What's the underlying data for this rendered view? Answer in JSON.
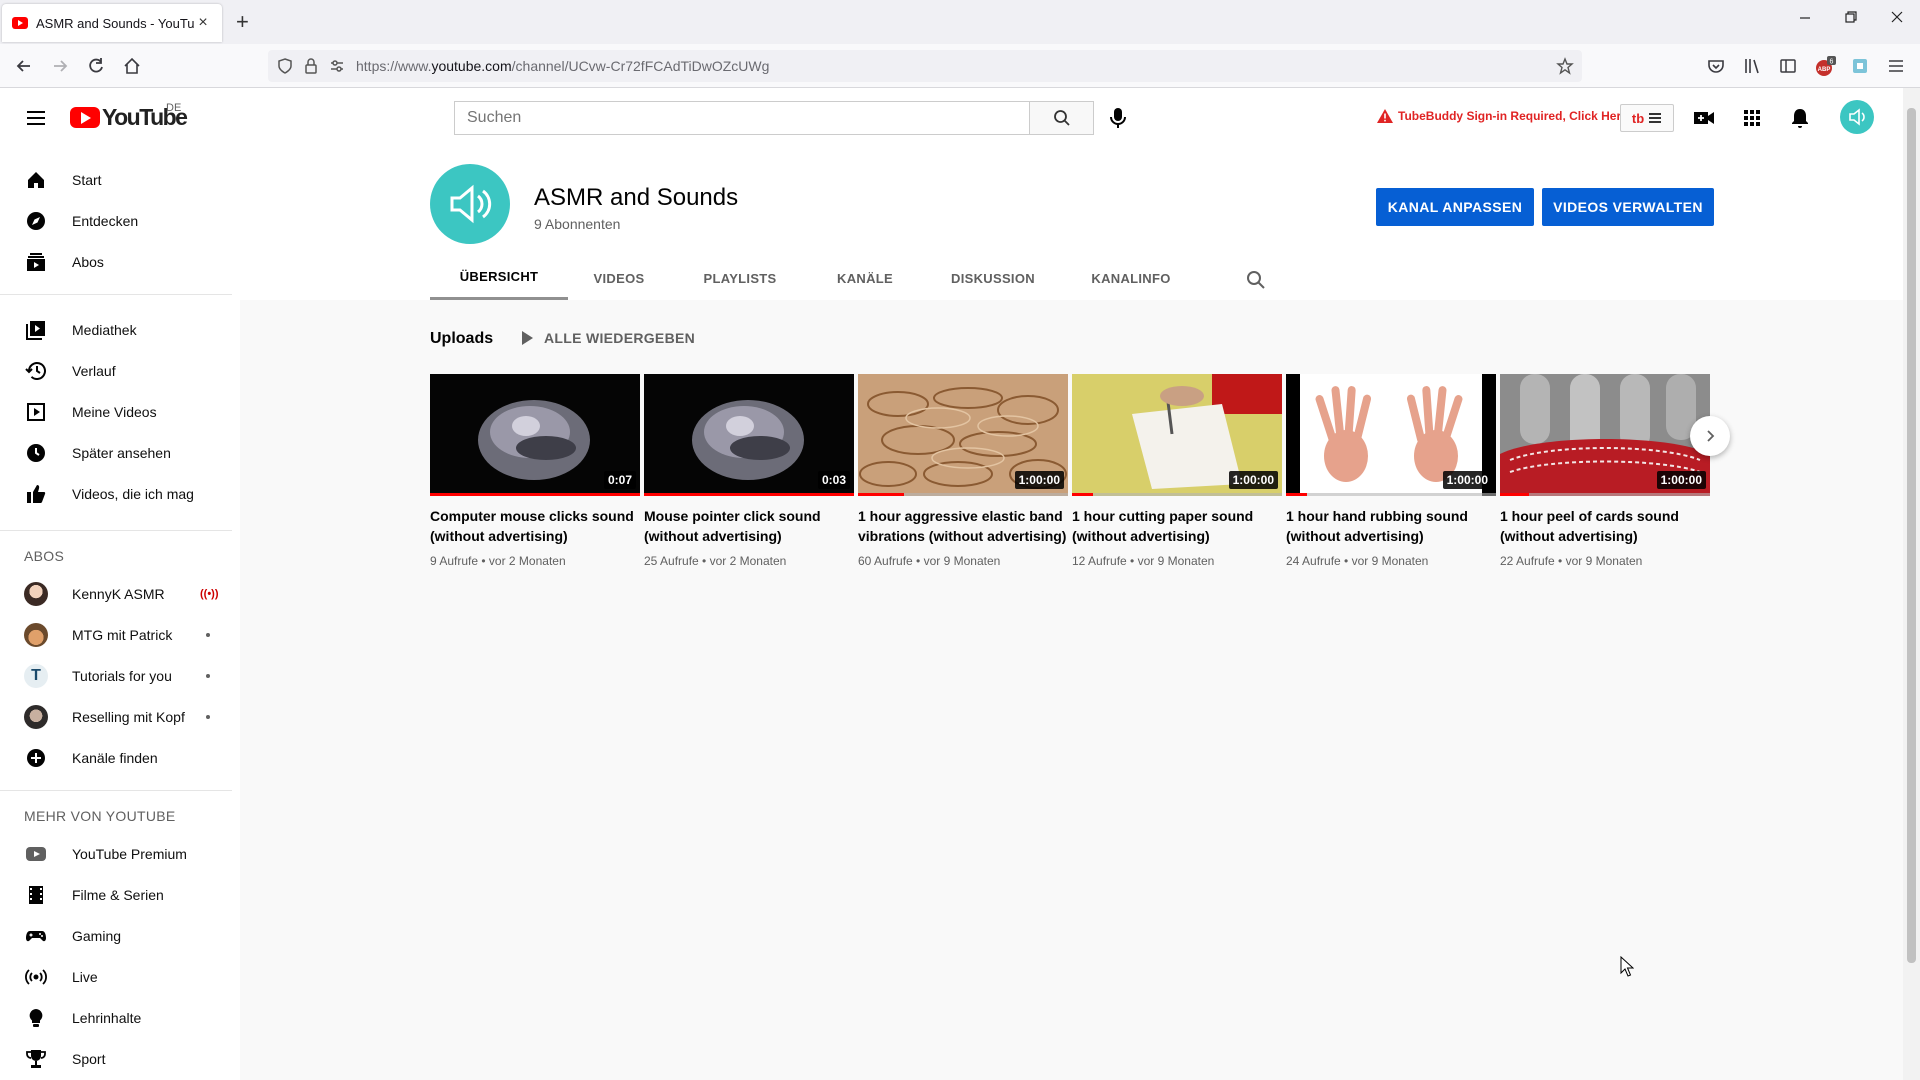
{
  "browser": {
    "tab_title": "ASMR and Sounds - YouTube",
    "url_prefix": "https://www.",
    "url_host": "youtube.com",
    "url_path": "/channel/UCvw-Cr72fFCAdTiDwOZcUWg",
    "ext_badge": "6"
  },
  "yt_header": {
    "logo_text": "YouTube",
    "country_code": "DE",
    "search_placeholder": "Suchen",
    "tubebuddy_warning": "TubeBuddy Sign-in Required, Click Here",
    "tb_badge": "tb"
  },
  "sidebar": {
    "main": [
      {
        "label": "Start",
        "icon": "home-icon"
      },
      {
        "label": "Entdecken",
        "icon": "compass-icon"
      },
      {
        "label": "Abos",
        "icon": "subscriptions-icon"
      }
    ],
    "library": [
      {
        "label": "Mediathek",
        "icon": "library-icon"
      },
      {
        "label": "Verlauf",
        "icon": "history-icon"
      },
      {
        "label": "Meine Videos",
        "icon": "my-videos-icon"
      },
      {
        "label": "Später ansehen",
        "icon": "clock-icon"
      },
      {
        "label": "Videos, die ich mag",
        "icon": "thumbs-up-icon"
      }
    ],
    "subs_header": "ABOS",
    "subs": [
      {
        "label": "KennyK ASMR",
        "live": "((•))"
      },
      {
        "label": "MTG mit Patrick"
      },
      {
        "label": "Tutorials for you",
        "initial": "T"
      },
      {
        "label": "Reselling mit Kopf"
      },
      {
        "label": "Kanäle finden",
        "icon": "add-circle-icon"
      }
    ],
    "more_header": "MEHR VON YOUTUBE",
    "more": [
      {
        "label": "YouTube Premium",
        "icon": "youtube-premium-icon"
      },
      {
        "label": "Filme & Serien",
        "icon": "film-icon"
      },
      {
        "label": "Gaming",
        "icon": "gamepad-icon"
      },
      {
        "label": "Live",
        "icon": "live-icon"
      },
      {
        "label": "Lehrinhalte",
        "icon": "lightbulb-icon"
      },
      {
        "label": "Sport",
        "icon": "trophy-icon"
      }
    ]
  },
  "channel": {
    "name": "ASMR and Sounds",
    "subscribers": "9 Abonnenten",
    "customize_label": "KANAL ANPASSEN",
    "manage_label": "VIDEOS VERWALTEN",
    "tabs": [
      "ÜBERSICHT",
      "VIDEOS",
      "PLAYLISTS",
      "KANÄLE",
      "DISKUSSION",
      "KANALINFO"
    ],
    "active_tab": "ÜBERSICHT"
  },
  "shelf": {
    "title": "Uploads",
    "play_all": "ALLE WIEDERGEBEN",
    "videos": [
      {
        "title": "Computer mouse clicks sound (without advertising)",
        "duration": "0:07",
        "views": "9 Aufrufe",
        "age": "vor 2 Monaten",
        "progress": 100
      },
      {
        "title": "Mouse pointer click sound (without advertising)",
        "duration": "0:03",
        "views": "25 Aufrufe",
        "age": "vor 2 Monaten",
        "progress": 100
      },
      {
        "title": "1 hour aggressive elastic band vibrations (without advertising)",
        "duration": "1:00:00",
        "views": "60 Aufrufe",
        "age": "vor 9 Monaten",
        "progress": 22
      },
      {
        "title": "1 hour cutting paper sound (without advertising)",
        "duration": "1:00:00",
        "views": "12 Aufrufe",
        "age": "vor 9 Monaten",
        "progress": 10
      },
      {
        "title": "1 hour hand rubbing sound (without advertising)",
        "duration": "1:00:00",
        "views": "24 Aufrufe",
        "age": "vor 9 Monaten",
        "progress": 10
      },
      {
        "title": "1 hour peel of cards sound (without advertising)",
        "duration": "1:00:00",
        "views": "22 Aufrufe",
        "age": "vor 9 Monaten",
        "progress": 14
      }
    ]
  },
  "colors": {
    "accent_blue": "#065fd4",
    "yt_red": "#ff0000",
    "channel_teal": "#3cc6c2"
  }
}
